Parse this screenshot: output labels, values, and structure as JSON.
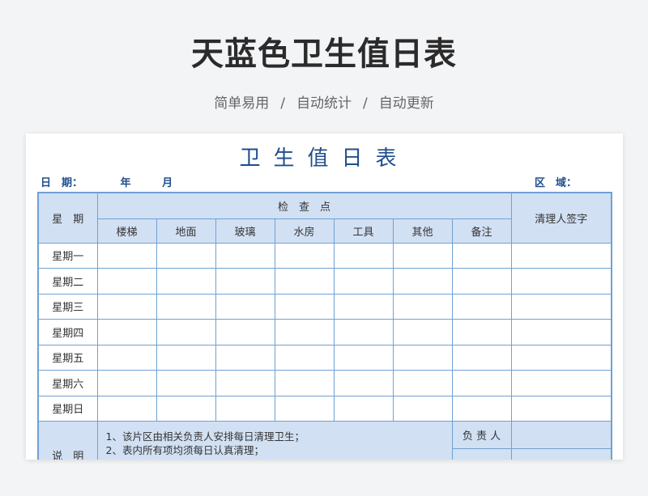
{
  "header": {
    "title": "天蓝色卫生值日表",
    "features": [
      "简单易用",
      "自动统计",
      "自动更新"
    ],
    "separator": "/"
  },
  "sheet": {
    "title": "卫生值日表",
    "date_label": "日　期：",
    "year_label": "年",
    "month_label": "月",
    "area_label": "区　域：",
    "table": {
      "day_header": "星　期",
      "check_header": "检　查　点",
      "signer_header": "清理人签字",
      "columns": [
        "楼梯",
        "地面",
        "玻璃",
        "水房",
        "工具",
        "其他",
        "备注"
      ],
      "days": [
        "星期一",
        "星期二",
        "星期三",
        "星期四",
        "星期五",
        "星期六",
        "星期日"
      ]
    },
    "notes": {
      "label": "说　明",
      "lines": [
        "1、该片区由相关负责人安排每日清理卫生；",
        "2、表内所有项均须每日认真清理；"
      ],
      "owner_label": "负 责 人"
    }
  }
}
